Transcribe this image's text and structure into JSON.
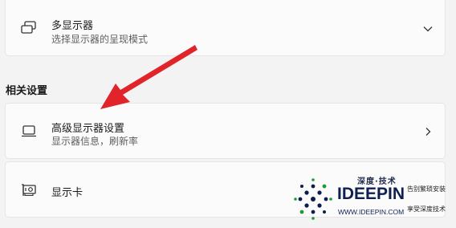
{
  "multi_display": {
    "title": "多显示器",
    "subtitle": "选择显示器的呈现模式",
    "icon": "multi-monitor-icon",
    "expander_icon": "chevron-down-icon"
  },
  "related_settings": {
    "heading": "相关设置",
    "items": [
      {
        "title": "高级显示器设置",
        "subtitle": "显示器信息，刷新率",
        "icon": "laptop-icon",
        "nav_icon": "chevron-right-icon"
      },
      {
        "title": "显示卡",
        "icon": "graphics-card-icon"
      }
    ]
  },
  "annotation": {
    "arrow_color": "#e0242a"
  },
  "watermark": {
    "top_text": "深度·技术",
    "brand": "IDEEPIN",
    "url": "WWW.IDEEPIN.COM",
    "side_line1": "告别繁琐安装",
    "side_line2": "享受深度技术"
  }
}
